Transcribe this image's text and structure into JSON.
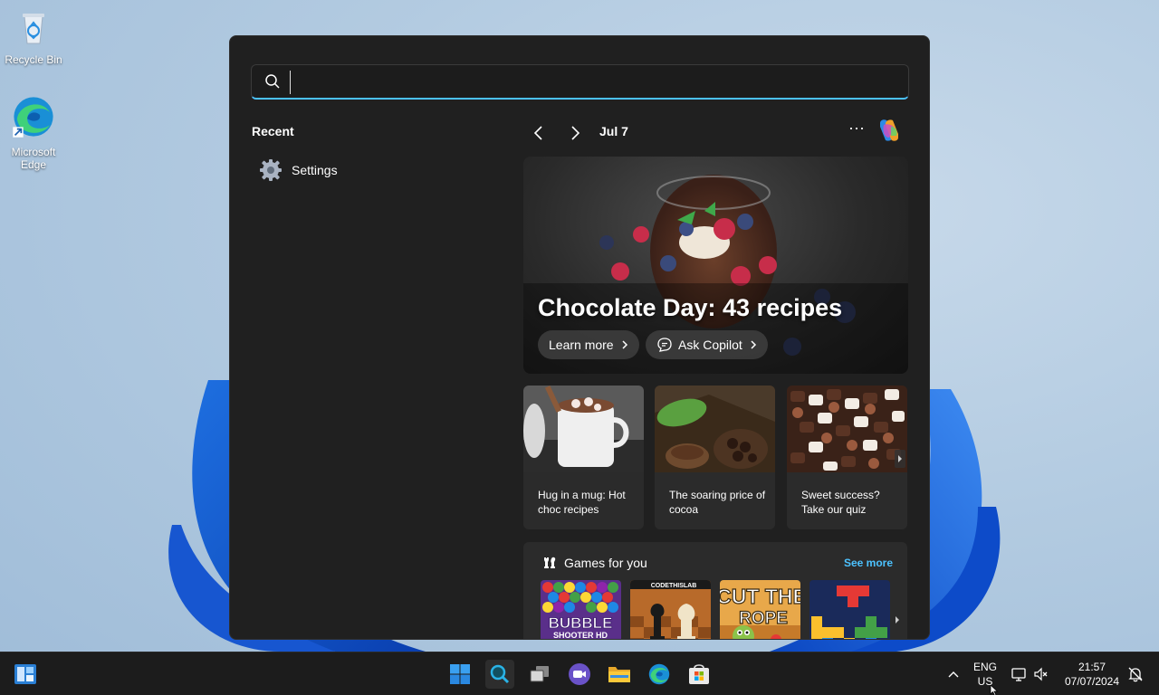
{
  "desktop": {
    "icons": [
      {
        "label": "Recycle Bin",
        "icon": "recycle-bin-icon"
      },
      {
        "label": "Microsoft Edge",
        "icon": "edge-icon"
      }
    ]
  },
  "search": {
    "placeholder": "",
    "value": ""
  },
  "recent": {
    "label": "Recent",
    "items": [
      {
        "label": "Settings",
        "icon": "gear-icon"
      }
    ]
  },
  "feed": {
    "date": "Jul 7",
    "more": "···",
    "hero": {
      "title": "Chocolate Day: 43 recipes",
      "learn_more": "Learn more",
      "ask_copilot": "Ask Copilot"
    },
    "cards": [
      {
        "text": "Hug in a mug: Hot choc recipes"
      },
      {
        "text": "The soaring price of cocoa"
      },
      {
        "text": "Sweet success? Take our quiz"
      }
    ],
    "games": {
      "title": "Games for you",
      "see_more": "See more",
      "tiles": [
        {
          "line1": "BUBBLE",
          "line2": "SHOOTER HD"
        },
        {
          "line1": "CODETHISLAB"
        },
        {
          "line1": "CUT THE",
          "line2": "ROPE"
        },
        {
          "line1": ""
        }
      ]
    }
  },
  "taskbar": {
    "lang_line1": "ENG",
    "lang_line2": "US",
    "time": "21:57",
    "date": "07/07/2024"
  },
  "colors": {
    "accent": "#4cc2ff",
    "panel_bg": "#202020",
    "card_bg": "#2b2b2b",
    "taskbar_bg": "#1c1c1c"
  }
}
